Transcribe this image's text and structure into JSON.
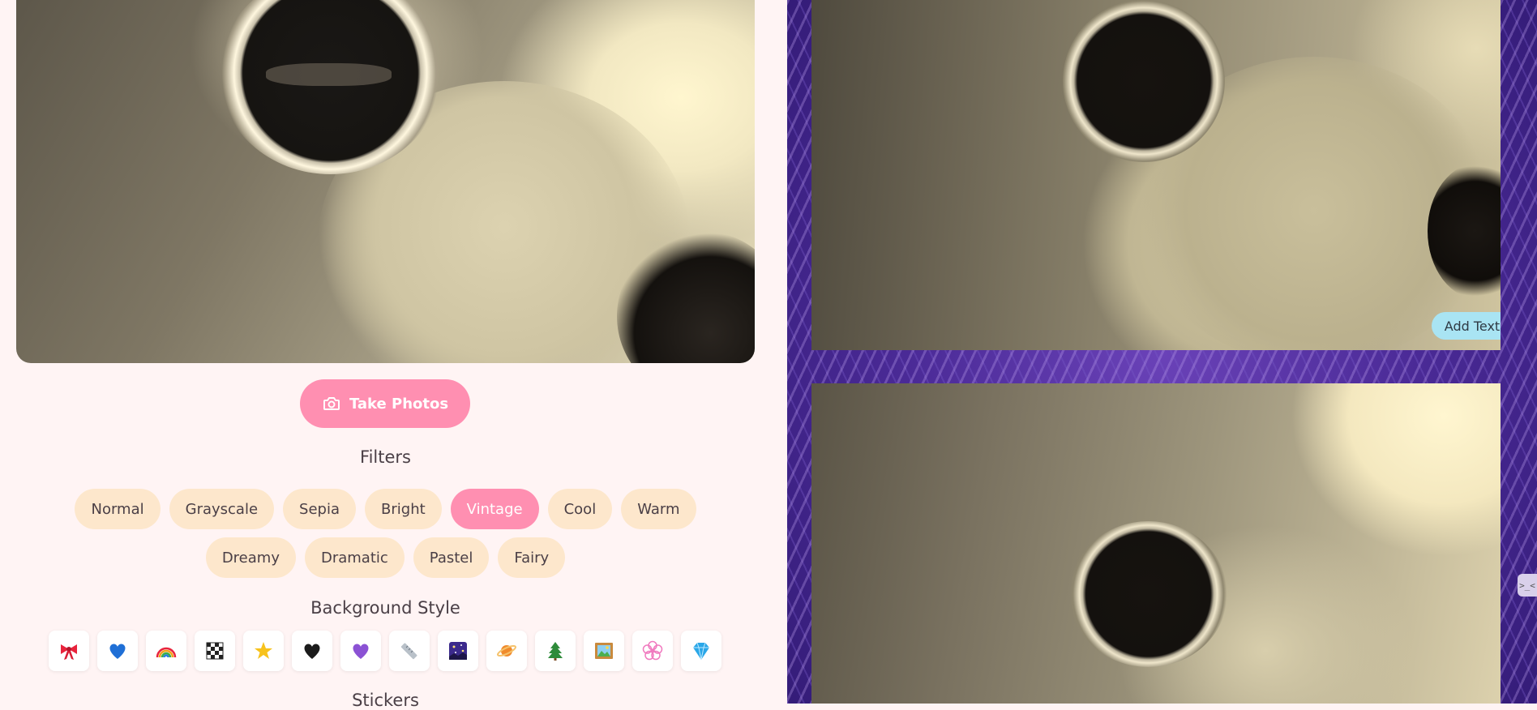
{
  "camera": {
    "take_photos_label": "Take Photos"
  },
  "filters": {
    "title": "Filters",
    "items": [
      {
        "label": "Normal",
        "active": false
      },
      {
        "label": "Grayscale",
        "active": false
      },
      {
        "label": "Sepia",
        "active": false
      },
      {
        "label": "Bright",
        "active": false
      },
      {
        "label": "Vintage",
        "active": true
      },
      {
        "label": "Cool",
        "active": false
      },
      {
        "label": "Warm",
        "active": false
      },
      {
        "label": "Dreamy",
        "active": false
      },
      {
        "label": "Dramatic",
        "active": false
      },
      {
        "label": "Pastel",
        "active": false
      },
      {
        "label": "Fairy",
        "active": false
      }
    ]
  },
  "background_style": {
    "title": "Background Style",
    "options": [
      {
        "icon": "ribbon-icon",
        "color": "#e8233c"
      },
      {
        "icon": "blue-heart-icon",
        "color": "#1f6fd6"
      },
      {
        "icon": "rainbow-icon",
        "color": "#f3a21a"
      },
      {
        "icon": "checkerboard-icon",
        "color": "#222222"
      },
      {
        "icon": "star-icon",
        "color": "#f7c21c"
      },
      {
        "icon": "black-heart-icon",
        "color": "#1b1b1b"
      },
      {
        "icon": "purple-heart-icon",
        "color": "#8b52d4"
      },
      {
        "icon": "ruler-icon",
        "color": "#9aa3ad"
      },
      {
        "icon": "starry-night-icon",
        "color": "#3b2a8c"
      },
      {
        "icon": "planet-icon",
        "color": "#f08a2c"
      },
      {
        "icon": "pine-tree-icon",
        "color": "#2e8b3a"
      },
      {
        "icon": "framed-picture-icon",
        "color": "#4aa3df"
      },
      {
        "icon": "flower-icon",
        "color": "#f07abf"
      },
      {
        "icon": "gem-icon",
        "color": "#2aa7e8"
      }
    ]
  },
  "stickers": {
    "title": "Stickers"
  },
  "photo_strip": {
    "add_text_label": "Add Text",
    "side_toggle_label": ">_<"
  }
}
